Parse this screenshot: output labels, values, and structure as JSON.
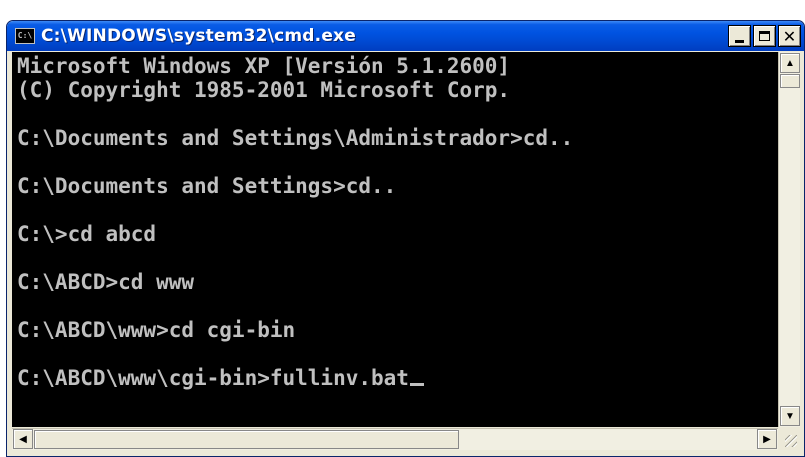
{
  "window": {
    "title": "C:\\WINDOWS\\system32\\cmd.exe",
    "icon": "cmd-icon",
    "icon_text": "C:\\",
    "buttons": {
      "minimize": "minimize-icon",
      "maximize": "maximize-icon",
      "close": "close-icon",
      "close_label": "✕"
    }
  },
  "console": {
    "background": "#000000",
    "foreground": "#c0c0c0",
    "lines": [
      "Microsoft Windows XP [Versión 5.1.2600]",
      "(C) Copyright 1985-2001 Microsoft Corp.",
      "",
      "C:\\Documents and Settings\\Administrador>cd..",
      "",
      "C:\\Documents and Settings>cd..",
      "",
      "C:\\>cd abcd",
      "",
      "C:\\ABCD>cd www",
      "",
      "C:\\ABCD\\www>cd cgi-bin",
      "",
      "C:\\ABCD\\www\\cgi-bin>fullinv.bat"
    ]
  },
  "scrollbars": {
    "up_arrow": "▲",
    "down_arrow": "▼",
    "left_arrow": "◀",
    "right_arrow": "▶"
  },
  "colors": {
    "titlebar": "#0053e1",
    "frame": "#ece9d8"
  }
}
